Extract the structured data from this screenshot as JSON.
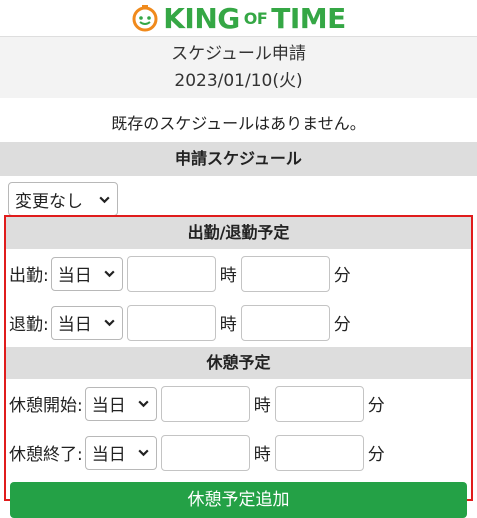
{
  "header": {
    "logo_text_a": "KING",
    "logo_text_of": "OF",
    "logo_text_b": "TIME",
    "page_title": "スケジュール申請",
    "date": "2023/01/10(火)"
  },
  "notice": "既存のスケジュールはありません。",
  "schedule_section": {
    "title": "申請スケジュール",
    "select_value": "変更なし"
  },
  "work_section": {
    "title": "出勤/退勤予定",
    "rows": [
      {
        "label": "出勤:",
        "day": "当日",
        "hour_unit": "時",
        "minute_unit": "分"
      },
      {
        "label": "退勤:",
        "day": "当日",
        "hour_unit": "時",
        "minute_unit": "分"
      }
    ]
  },
  "break_section": {
    "title": "休憩予定",
    "rows": [
      {
        "label": "休憩開始:",
        "day": "当日",
        "hour_unit": "時",
        "minute_unit": "分"
      },
      {
        "label": "休憩終了:",
        "day": "当日",
        "hour_unit": "時",
        "minute_unit": "分"
      }
    ],
    "add_button": "休憩予定追加"
  },
  "colors": {
    "brand_green": "#35a745",
    "button_green": "#24a146",
    "highlight_red": "#e01c1c"
  }
}
